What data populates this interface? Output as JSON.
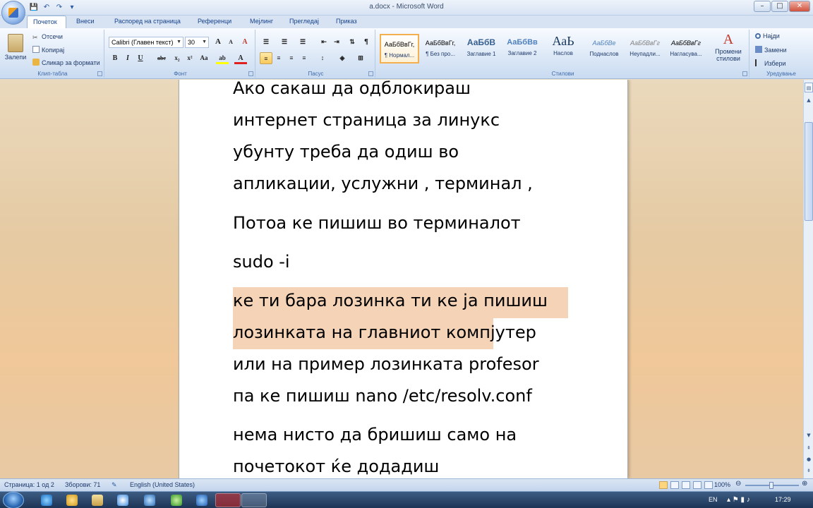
{
  "window": {
    "title": "a.docx - Microsoft Word",
    "minimize": "–",
    "maximize": "□",
    "close": "✕"
  },
  "qat": [
    "💾",
    "↶",
    "↷",
    "▾"
  ],
  "tabs": [
    {
      "label": "Почеток"
    },
    {
      "label": "Внеси"
    },
    {
      "label": "Распоред на страница"
    },
    {
      "label": "Референци"
    },
    {
      "label": "Мејлинг"
    },
    {
      "label": "Прегледај"
    },
    {
      "label": "Приказ"
    }
  ],
  "clipboard": {
    "paste": "Залепи",
    "cut": "Отсечи",
    "copy": "Копирај",
    "format_painter": "Сликар за формати",
    "label": "Клип-табла"
  },
  "font": {
    "name": "Calibri (Главен текст)",
    "size": "30",
    "grow": "A",
    "shrink": "A",
    "clear": "A",
    "bold": "B",
    "italic": "I",
    "underline": "U",
    "strike": "abe",
    "sub": "x₂",
    "sup": "x²",
    "case": "Aa",
    "highlight": "ab",
    "color": "A",
    "label": "Фонт"
  },
  "paragraph": {
    "label": "Пасус",
    "pilcrow": "¶"
  },
  "styles": {
    "label": "Стилови",
    "items": [
      {
        "preview": "АаБбВвГг,",
        "name": "¶ Нормал..."
      },
      {
        "preview": "АаБбВвГг,",
        "name": "¶ Без про..."
      },
      {
        "preview": "АаБбВ",
        "name": "Заглавие 1"
      },
      {
        "preview": "АаБбВв",
        "name": "Заглавие 2"
      },
      {
        "preview": "АаЬ",
        "name": "Наслов"
      },
      {
        "preview": "АаБбВе",
        "name": "Поднаслов"
      },
      {
        "preview": "АаБбВвГг",
        "name": "Неупадли..."
      },
      {
        "preview": "АаБбВвГг",
        "name": "Нагласува..."
      }
    ],
    "change": "Промени стилови"
  },
  "editing": {
    "label": "Уредување",
    "find": "Најди",
    "replace": "Замени",
    "select": "Избери"
  },
  "document": {
    "lines": [
      "Ако сакаш да одблокираш",
      "интернет страница за линукс",
      "убунту треба да одиш во",
      "апликации, услужни , терминал ,",
      "Потоа ке пишиш во терминалот",
      "sudo -i",
      "ке ти бара лозинка ти ке ја пишиш",
      "лозинката на главниот компјутер",
      "или на пример лозинката profesor",
      "па ке пишиш nano /etc/resolv.conf",
      "нема нисто да бришиш само на",
      "почетокот ќе додадиш"
    ]
  },
  "status": {
    "page": "Страница: 1 од 2",
    "words": "Зборови: 71",
    "language": "English (United States)",
    "zoom": "100%"
  },
  "taskbar": {
    "lang": "EN",
    "time": "17:29"
  }
}
